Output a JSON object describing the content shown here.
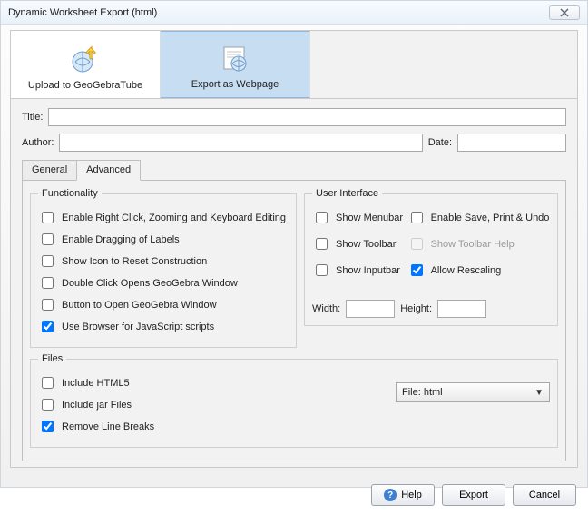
{
  "window": {
    "title": "Dynamic Worksheet Export (html)"
  },
  "modes": {
    "tube": "Upload to GeoGebraTube",
    "web": "Export as Webpage"
  },
  "fields": {
    "title_label": "Title:",
    "author_label": "Author:",
    "date_label": "Date:",
    "title_value": "",
    "author_value": "",
    "date_value": ""
  },
  "tabs": {
    "general": "General",
    "advanced": "Advanced"
  },
  "groups": {
    "functionality": "Functionality",
    "user_interface": "User Interface",
    "files": "Files"
  },
  "func": {
    "right_click": {
      "label": "Enable Right Click, Zooming and Keyboard Editing",
      "checked": false
    },
    "drag_labels": {
      "label": "Enable Dragging of Labels",
      "checked": false
    },
    "reset_icon": {
      "label": "Show Icon to Reset Construction",
      "checked": false
    },
    "dblclick": {
      "label": "Double Click Opens GeoGebra Window",
      "checked": false
    },
    "open_btn": {
      "label": "Button to Open GeoGebra Window",
      "checked": false
    },
    "browser_js": {
      "label": "Use Browser for JavaScript scripts",
      "checked": true
    }
  },
  "ui": {
    "menubar": {
      "label": "Show Menubar",
      "checked": false
    },
    "save_print": {
      "label": "Enable Save, Print & Undo",
      "checked": false
    },
    "toolbar": {
      "label": "Show Toolbar",
      "checked": false
    },
    "tb_help": {
      "label": "Show Toolbar Help",
      "checked": false,
      "disabled": true
    },
    "inputbar": {
      "label": "Show Inputbar",
      "checked": false
    },
    "rescaling": {
      "label": "Allow Rescaling",
      "checked": true
    },
    "width_label": "Width:",
    "height_label": "Height:",
    "width_value": "",
    "height_value": ""
  },
  "files": {
    "html5": {
      "label": "Include HTML5",
      "checked": false
    },
    "jar": {
      "label": "Include jar Files",
      "checked": false
    },
    "linebreaks": {
      "label": "Remove Line Breaks",
      "checked": true
    },
    "file_select": "File: html"
  },
  "buttons": {
    "help": "Help",
    "export": "Export",
    "cancel": "Cancel"
  }
}
